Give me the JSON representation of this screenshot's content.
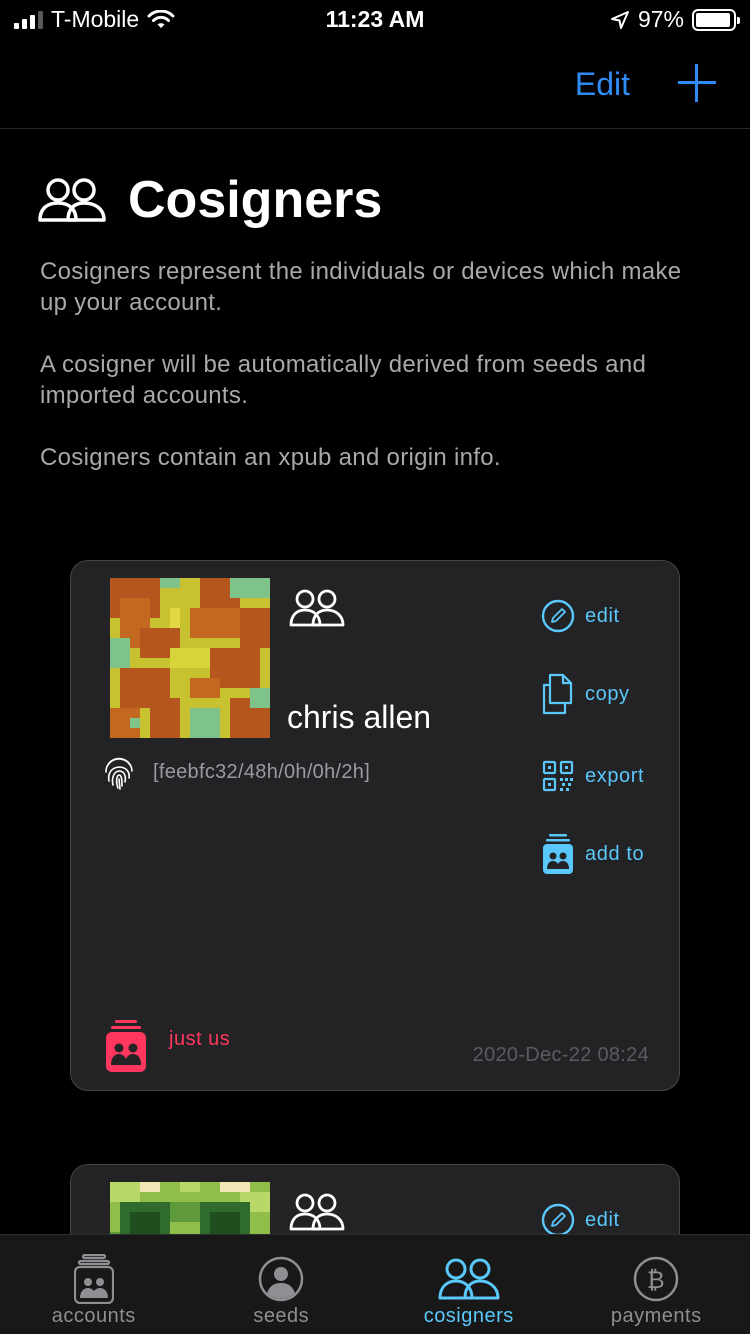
{
  "status_bar": {
    "carrier": "T-Mobile",
    "time": "11:23 AM",
    "battery": "97%",
    "battery_level": 0.97
  },
  "nav": {
    "edit_label": "Edit",
    "add_icon": "plus-icon"
  },
  "page": {
    "title": "Cosigners",
    "title_icon": "people-icon",
    "description": [
      "Cosigners represent the individuals or devices which make up your account.",
      "A cosigner will be automatically derived from seeds and imported accounts.",
      "Cosigners contain an xpub and origin info."
    ]
  },
  "cosigners": [
    {
      "name": "chris allen",
      "path": "[feebfc32/48h/0h/0h/2h]",
      "policy": "just us",
      "date": "2020-Dec-22 08:24",
      "actions": [
        "edit",
        "copy",
        "export",
        "add to"
      ]
    },
    {
      "actions": [
        "edit"
      ]
    }
  ],
  "tabs": [
    {
      "label": "accounts",
      "icon": "accounts-icon"
    },
    {
      "label": "seeds",
      "icon": "person-circle-icon"
    },
    {
      "label": "cosigners",
      "icon": "people-icon"
    },
    {
      "label": "payments",
      "icon": "bitcoin-icon"
    }
  ],
  "colors": {
    "accent_blue": "#2f8cf6",
    "action_cyan": "#5ac8fa",
    "policy_red": "#ff375f",
    "card_bg": "#232325"
  }
}
